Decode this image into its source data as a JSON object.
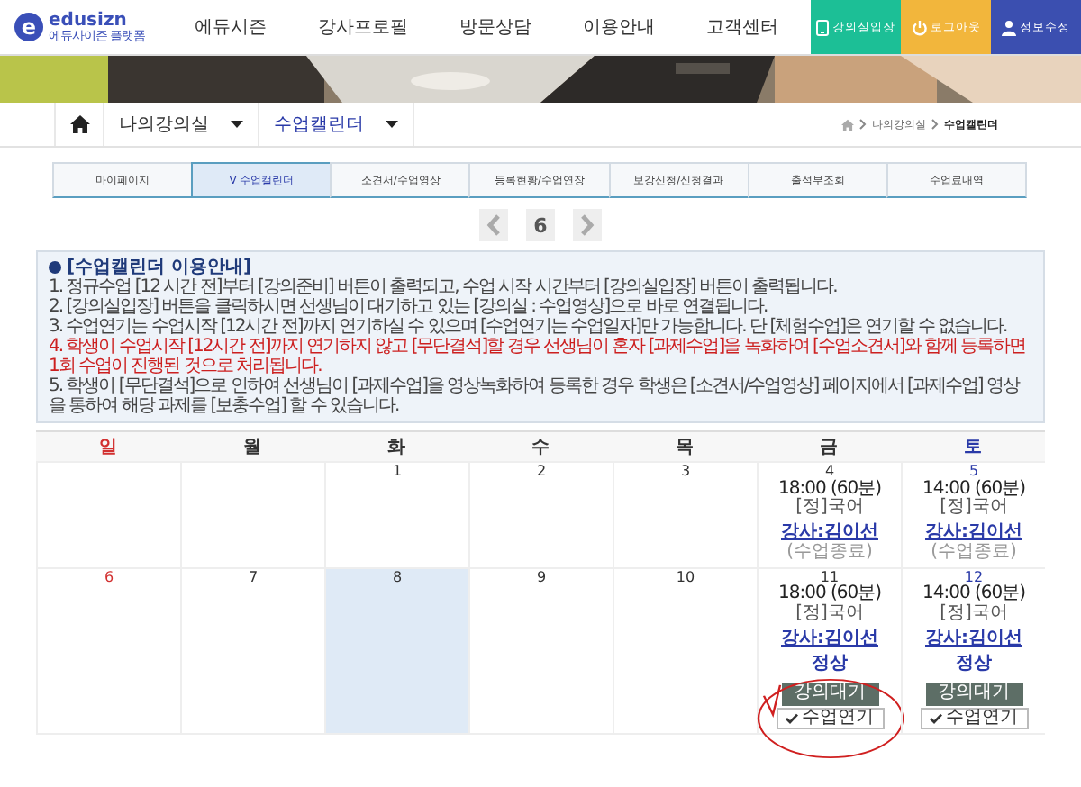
{
  "header": {
    "logo": {
      "mark": "e",
      "name": "edusizn",
      "tagline": "에듀사이즌 플랫폼"
    },
    "nav": [
      "에듀시즌",
      "강사프로필",
      "방문상담",
      "이용안내",
      "고객센터"
    ],
    "actions": [
      {
        "label": "강의실입장",
        "kind": "tablet",
        "color": "#1cbf96"
      },
      {
        "label": "로그아웃",
        "kind": "power",
        "color": "#f2b63c"
      },
      {
        "label": "정보수정",
        "kind": "person",
        "color": "#3b4fb0"
      }
    ]
  },
  "breadcrumb": {
    "menus": [
      "나의강의실",
      "수업캘린더"
    ],
    "path": [
      "나의강의실",
      "수업캘린더"
    ]
  },
  "tabs": [
    {
      "label": "마이페이지",
      "selected": false
    },
    {
      "label": "V 수업캘린더",
      "selected": true
    },
    {
      "label": "소견서/수업영상",
      "selected": false
    },
    {
      "label": "등록현황/수업연장",
      "selected": false
    },
    {
      "label": "보강신청/신청결과",
      "selected": false
    },
    {
      "label": "출석부조회",
      "selected": false
    },
    {
      "label": "수업료내역",
      "selected": false
    }
  ],
  "pager": {
    "week": "6"
  },
  "notice": {
    "title": "[수업캘린더 이용안내]",
    "lines": [
      {
        "text": "1. 정규수업 [12 시간 전]부터 [강의준비] 버튼이 출력되고, 수업 시작 시간부터 [강의실입장] 버튼이 출력됩니다.",
        "highlight": false
      },
      {
        "text": "2. [강의실입장] 버튼을 클릭하시면 선생님이 대기하고 있는 [강의실 : 수업영상]으로 바로 연결됩니다.",
        "highlight": false
      },
      {
        "text": "3. 수업연기는 수업시작 [12시간 전]까지 연기하실 수 있으며 [수업연기는 수업일자]만 가능합니다. 단 [체험수업]은 연기할 수 없습니다.",
        "highlight": false
      },
      {
        "text": "4. 학생이 수업시작 [12시간 전]까지 연기하지 않고 [무단결석]할 경우 선생님이 혼자 [과제수업]을 녹화하여 [수업소견서]와 함께 등록하면 1회 수업이 진행된 것으로 처리됩니다.",
        "highlight": true
      },
      {
        "text": "5. 학생이 [무단결석]으로 인하여 선생님이 [과제수업]을 영상녹화하여 등록한 경우 학생은 [소견서/수업영상] 페이지에서 [과제수업] 영상을 통하여 해당 과제를 [보충수업] 할 수 있습니다.",
        "highlight": false
      }
    ]
  },
  "calendar": {
    "weekdays": [
      {
        "label": "일",
        "kind": "sunday"
      },
      {
        "label": "월",
        "kind": "weekday"
      },
      {
        "label": "화",
        "kind": "weekday"
      },
      {
        "label": "수",
        "kind": "weekday"
      },
      {
        "label": "목",
        "kind": "weekday"
      },
      {
        "label": "금",
        "kind": "weekday"
      },
      {
        "label": "토",
        "kind": "saturday"
      }
    ],
    "weeks": [
      [
        {
          "kind": "blank"
        },
        {
          "kind": "blank"
        },
        {
          "day": "1",
          "kind": "weekday",
          "today": false
        },
        {
          "day": "2",
          "kind": "weekday",
          "today": false
        },
        {
          "day": "3",
          "kind": "weekday",
          "today": false
        },
        {
          "day": "4",
          "kind": "weekday",
          "today": false,
          "lesson": {
            "time": "18:00 (60분)",
            "subject": "[정]국어",
            "teacher": "강사:김이선",
            "status": "(수업종료)",
            "kind": "finished",
            "circled": false
          }
        },
        {
          "day": "5",
          "kind": "saturday",
          "today": false,
          "lesson": {
            "time": "14:00 (60분)",
            "subject": "[정]국어",
            "teacher": "강사:김이선",
            "status": "(수업종료)",
            "kind": "finished",
            "circled": false
          }
        }
      ],
      [
        {
          "day": "6",
          "kind": "sunday",
          "today": false
        },
        {
          "day": "7",
          "kind": "weekday",
          "today": false
        },
        {
          "day": "8",
          "kind": "weekday",
          "today": true
        },
        {
          "day": "9",
          "kind": "weekday",
          "today": false
        },
        {
          "day": "10",
          "kind": "weekday",
          "today": false
        },
        {
          "day": "11",
          "kind": "weekday",
          "today": false,
          "lesson": {
            "time": "18:00 (60분)",
            "subject": "[정]국어",
            "teacher": "강사:김이선",
            "status": "정상",
            "kind": "upcoming",
            "circled": true,
            "wait": "강의대기",
            "postpone": "수업연기"
          }
        },
        {
          "day": "12",
          "kind": "saturday",
          "today": false,
          "lesson": {
            "time": "14:00 (60분)",
            "subject": "[정]국어",
            "teacher": "강사:김이선",
            "status": "정상",
            "kind": "upcoming",
            "circled": false,
            "wait": "강의대기",
            "postpone": "수업연기"
          }
        }
      ]
    ]
  }
}
